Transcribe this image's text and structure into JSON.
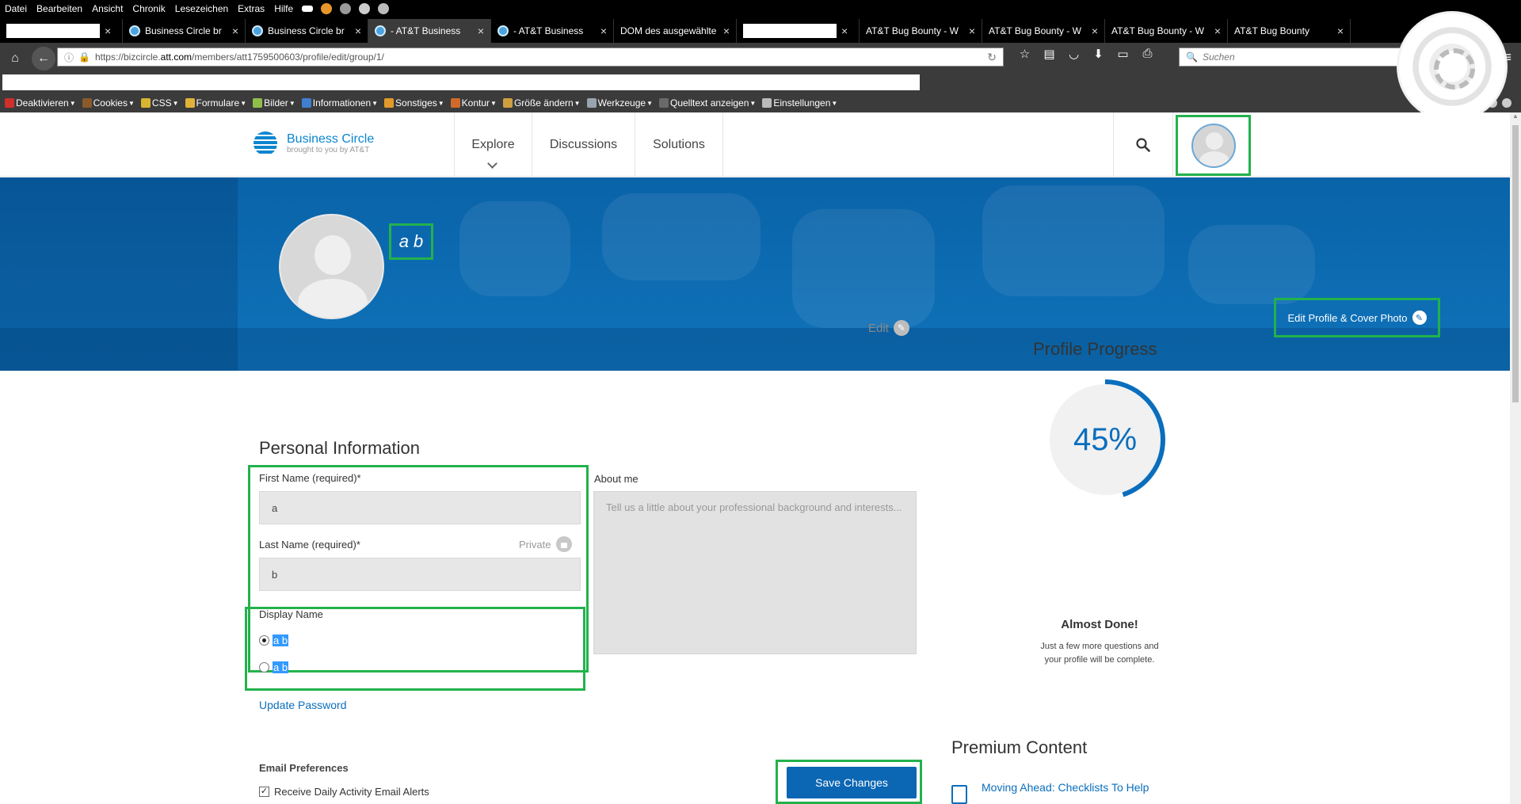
{
  "browser": {
    "menu": [
      "Datei",
      "Bearbeiten",
      "Ansicht",
      "Chronik",
      "Lesezeichen",
      "Extras",
      "Hilfe"
    ],
    "tabs": [
      {
        "label": "",
        "blank": true
      },
      {
        "label": "Business Circle br"
      },
      {
        "label": "Business Circle br"
      },
      {
        "label": "- AT&T Business",
        "active": true
      },
      {
        "label": "- AT&T Business"
      },
      {
        "label": "DOM des ausgewählte"
      },
      {
        "label": "",
        "blank": true
      },
      {
        "label": "AT&T Bug Bounty - W"
      },
      {
        "label": "AT&T Bug Bounty - W"
      },
      {
        "label": "AT&T Bug Bounty - W"
      },
      {
        "label": "AT&T Bug Bounty"
      }
    ],
    "url_pre": "https://bizcircle.",
    "url_host": "att.com",
    "url_post": "/members/att1759500603/profile/edit/group/1/",
    "search_placeholder": "Suchen",
    "devtools": [
      "Deaktivieren",
      "Cookies",
      "CSS",
      "Formulare",
      "Bilder",
      "Informationen",
      "Sonstiges",
      "Kontur",
      "Größe ändern",
      "Werkzeuge",
      "Quelltext anzeigen",
      "Einstellungen"
    ]
  },
  "site": {
    "logo_title": "Business Circle",
    "logo_sub": "brought to you by AT&T",
    "nav": {
      "explore": "Explore",
      "discussions": "Discussions",
      "solutions": "Solutions"
    }
  },
  "banner": {
    "display_name": "a b",
    "edit_cover": "Edit Profile & Cover Photo"
  },
  "form": {
    "edit": "Edit",
    "section_title": "Personal Information",
    "first_name_label": "First Name (required)*",
    "first_name_value": "a",
    "last_name_label": "Last Name (required)*",
    "last_name_value": "b",
    "private": "Private",
    "about_label": "About me",
    "about_placeholder": "Tell us a little about your professional background and interests...",
    "display_name_label": "Display Name",
    "display_options": [
      "a b",
      "a b"
    ],
    "update_password": "Update Password",
    "email_prefs": "Email Preferences",
    "daily_alerts": "Receive Daily Activity Email Alerts",
    "save": "Save Changes"
  },
  "progress": {
    "title": "Profile Progress",
    "percent_label": "45%",
    "percent": 45,
    "almost": "Almost Done!",
    "sub1": "Just a few more questions and",
    "sub2": "your profile will be complete."
  },
  "premium": {
    "title": "Premium Content",
    "item": "Moving Ahead: Checklists To Help"
  },
  "colors": {
    "brand": "#0a86cf",
    "banner": "#0f73ba",
    "highlight": "#22b24c",
    "button": "#0b66b3"
  }
}
